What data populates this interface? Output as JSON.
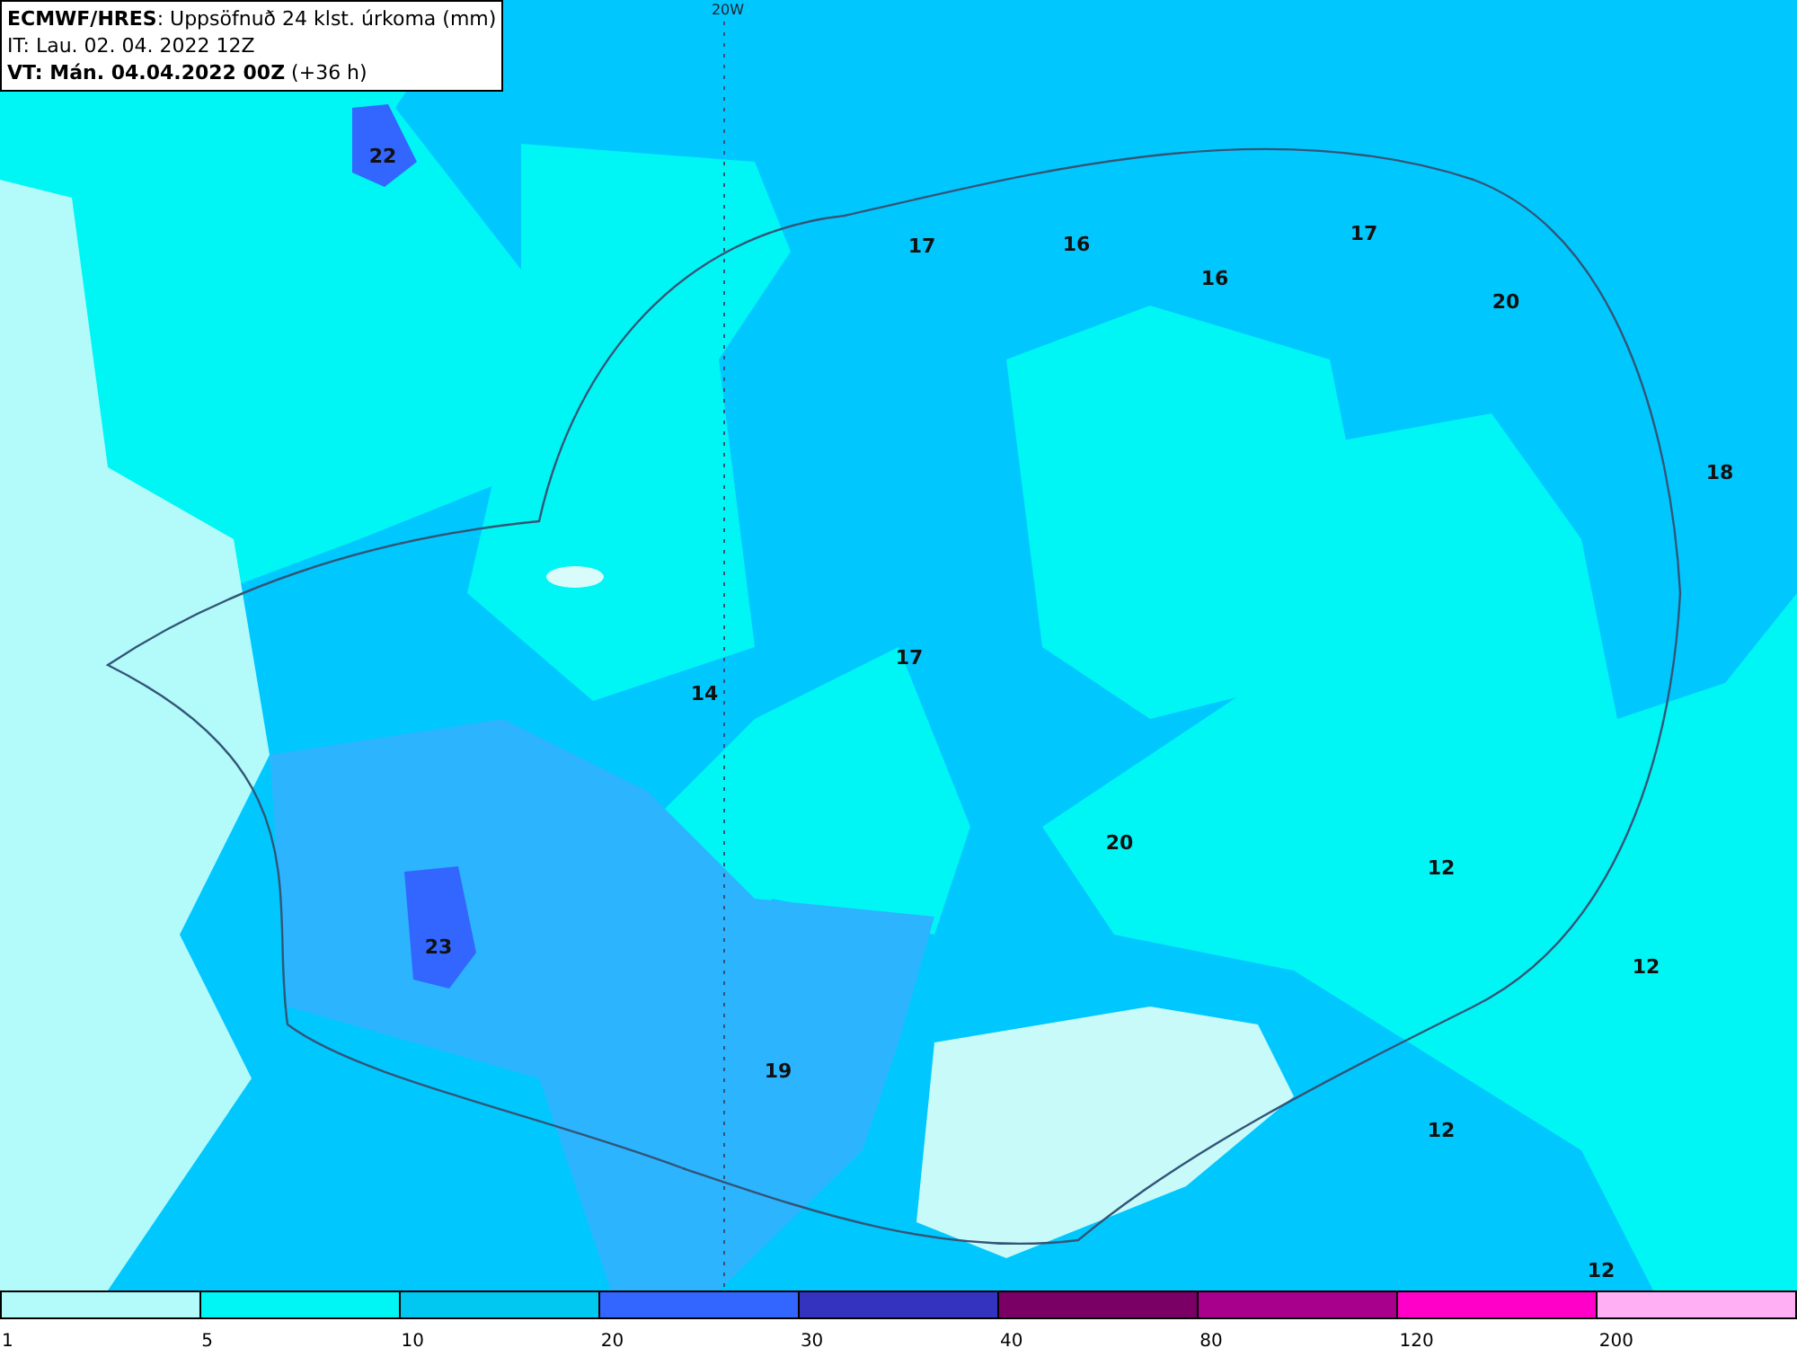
{
  "header": {
    "model": "ECMWF/HRES",
    "title": ": Uppsöfnuð 24 klst. úrkoma (mm)",
    "init_time": "IT: Lau. 02. 04. 2022 12Z",
    "valid_time": "VT: Mán. 04.04.2022 00Z",
    "lead": " (+36 h)"
  },
  "map": {
    "meridian_label": "20W",
    "values": [
      "22",
      "17",
      "16",
      "16",
      "17",
      "20",
      "18",
      "14",
      "17",
      "20",
      "12",
      "23",
      "12",
      "19",
      "12",
      "12"
    ]
  },
  "legend": [
    {
      "label": "1",
      "color": "#b3fafa"
    },
    {
      "label": "5",
      "color": "#00f5f5"
    },
    {
      "label": "10",
      "color": "#00c8f0"
    },
    {
      "label": "20",
      "color": "#3366ff"
    },
    {
      "label": "30",
      "color": "#3333c0"
    },
    {
      "label": "40",
      "color": "#7a0066"
    },
    {
      "label": "80",
      "color": "#a8008c"
    },
    {
      "label": "120",
      "color": "#ff00c8"
    },
    {
      "label": "200",
      "color": "#ffb0f5"
    }
  ]
}
